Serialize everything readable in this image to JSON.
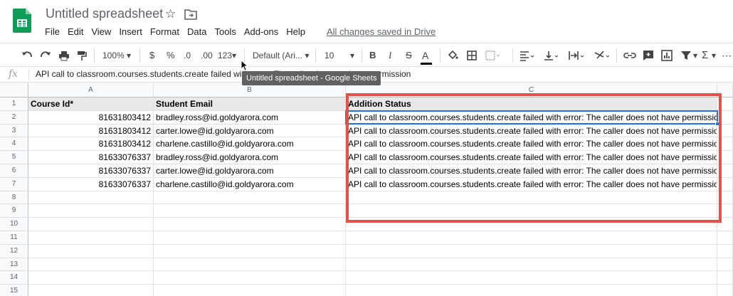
{
  "app": {
    "title": "Untitled spreadsheet",
    "saved_status": "All changes saved in Drive"
  },
  "menu": [
    "File",
    "Edit",
    "View",
    "Insert",
    "Format",
    "Data",
    "Tools",
    "Add-ons",
    "Help"
  ],
  "toolbar": {
    "zoom": "100%",
    "currency": "$",
    "percent": "%",
    "decrease_decimal": ".0",
    "increase_decimal": ".00",
    "more_formats": "123",
    "font": "Default (Ari...",
    "font_size": "10",
    "bold": "B",
    "italic": "I",
    "strike": "S",
    "text_color": "A"
  },
  "formula_bar": {
    "fx": "fx",
    "content": "API call to classroom.courses.students.create failed with error: The caller does not have permission"
  },
  "tooltip": "Untitled spreadsheet - Google Sheets",
  "grid": {
    "columns": [
      "A",
      "B",
      "C"
    ],
    "row_numbers": [
      "1",
      "2",
      "3",
      "4",
      "5",
      "6",
      "7",
      "8",
      "9",
      "10",
      "11",
      "12",
      "13",
      "14",
      "15"
    ],
    "header_row": [
      "Course Id*",
      "Student Email",
      "Addition Status"
    ],
    "rows": [
      [
        "81631803412",
        "bradley.ross@id.goldyarora.com",
        "API call to classroom.courses.students.create failed with error: The caller does not have permission"
      ],
      [
        "81631803412",
        "carter.lowe@id.goldyarora.com",
        "API call to classroom.courses.students.create failed with error: The caller does not have permission"
      ],
      [
        "81631803412",
        "charlene.castillo@id.goldyarora.com",
        "API call to classroom.courses.students.create failed with error: The caller does not have permission"
      ],
      [
        "81633076337",
        "bradley.ross@id.goldyarora.com",
        "API call to classroom.courses.students.create failed with error: The caller does not have permission"
      ],
      [
        "81633076337",
        "carter.lowe@id.goldyarora.com",
        "API call to classroom.courses.students.create failed with error: The caller does not have permission"
      ],
      [
        "81633076337",
        "charlene.castillo@id.goldyarora.com",
        "API call to classroom.courses.students.create failed with error: The caller does not have permission"
      ]
    ]
  },
  "colors": {
    "sheets_green": "#0f9d58",
    "selection_blue": "#1a73e8",
    "highlight_red": "#e0524a"
  }
}
